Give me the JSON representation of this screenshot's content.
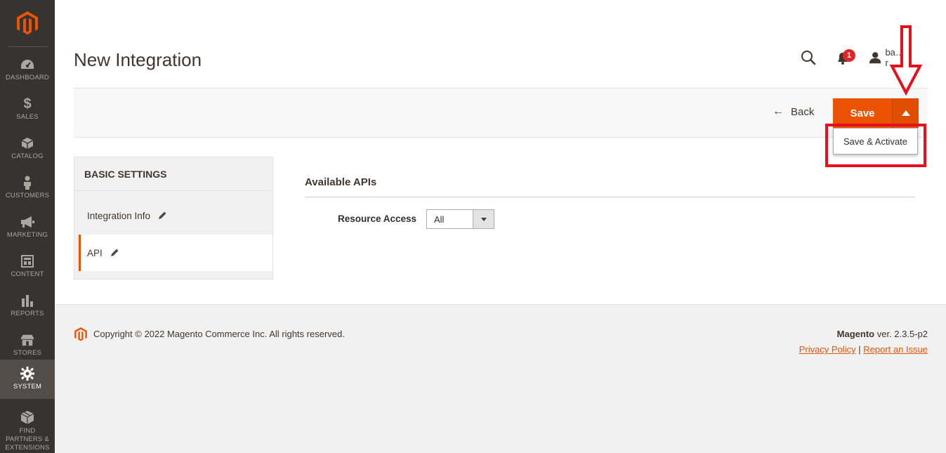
{
  "sidebar": {
    "items": [
      {
        "label": "DASHBOARD",
        "icon": "dashboard-icon"
      },
      {
        "label": "SALES",
        "icon": "dollar-icon"
      },
      {
        "label": "CATALOG",
        "icon": "box-icon"
      },
      {
        "label": "CUSTOMERS",
        "icon": "person-icon"
      },
      {
        "label": "MARKETING",
        "icon": "megaphone-icon"
      },
      {
        "label": "CONTENT",
        "icon": "layout-icon"
      },
      {
        "label": "REPORTS",
        "icon": "bar-chart-icon"
      },
      {
        "label": "STORES",
        "icon": "store-icon"
      },
      {
        "label": "SYSTEM",
        "icon": "gear-icon"
      },
      {
        "label": "FIND PARTNERS & EXTENSIONS",
        "icon": "cubes-icon"
      }
    ]
  },
  "header": {
    "title": "New Integration",
    "notifications_count": "1",
    "user_name": "ba…r"
  },
  "actions": {
    "back_label": "Back",
    "save_label": "Save",
    "dropdown_item": "Save & Activate"
  },
  "tabs": {
    "title": "BASIC SETTINGS",
    "items": [
      {
        "label": "Integration Info"
      },
      {
        "label": "API"
      }
    ]
  },
  "content": {
    "section_title": "Available APIs",
    "resource_access_label": "Resource Access",
    "resource_access_value": "All"
  },
  "footer": {
    "copyright": "Copyright © 2022 Magento Commerce Inc. All rights reserved.",
    "brand": "Magento",
    "version": " ver. 2.3.5-p2",
    "privacy": "Privacy Policy",
    "separator": " | ",
    "report": "Report an Issue"
  },
  "colors": {
    "accent": "#eb5202",
    "sidebar": "#373330",
    "annotation": "#e80f1d"
  }
}
